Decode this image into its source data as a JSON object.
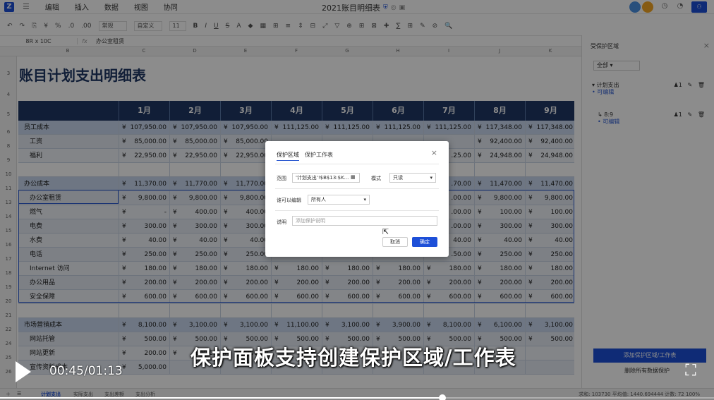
{
  "app": {
    "logo": "Z",
    "menu": [
      "编辑",
      "插入",
      "数据",
      "视图",
      "协同"
    ],
    "title": "2021账目明细表"
  },
  "toolbar": {
    "items": [
      "↶",
      "↷",
      "⎘",
      "¥",
      "%",
      ".0",
      ".00"
    ],
    "format_select": "常规",
    "font_select": "自定义",
    "size_select": "11",
    "style_items": [
      "B",
      "I",
      "U",
      "S",
      "A",
      "◆",
      "▦",
      "⊞",
      "≡",
      "⇕",
      "⊟",
      "⤢",
      "▽",
      "⊕",
      "⊞",
      "⊠",
      "✚",
      "∑",
      "⊞",
      "✎",
      "⊘",
      "🔍"
    ]
  },
  "formula_bar": {
    "name_box": "8R x 10C",
    "fx": "fx",
    "value": "办公室租赁"
  },
  "sheet": {
    "columns": [
      "B",
      "C",
      "D",
      "E",
      "F",
      "G",
      "H",
      "I",
      "J",
      "K"
    ],
    "title": "账目计划支出明细表",
    "months": [
      "1月",
      "2月",
      "3月",
      "4月",
      "5月",
      "6月",
      "7月",
      "8月",
      "9月"
    ],
    "currency": "¥",
    "rows": [
      {
        "num": "6",
        "kind": "cat",
        "label": "员工成本",
        "cur": "¥",
        "values": [
          "107,950.00",
          "107,950.00",
          "107,950.00",
          "111,125.00",
          "111,125.00",
          "111,125.00",
          "111,125.00",
          "117,348.00",
          "117,348.00"
        ],
        "prefix_inline": true
      },
      {
        "num": "8",
        "kind": "sub1",
        "label": "工资",
        "cur": "¥",
        "values": [
          "85,000.00",
          "85,000.00",
          "85,000.00",
          "",
          "",
          "",
          "",
          "92,400.00",
          "92,400.00"
        ]
      },
      {
        "num": "9",
        "kind": "sub2",
        "label": "福利",
        "cur": "¥",
        "values": [
          "22,950.00",
          "22,950.00",
          "22,950.00",
          "",
          "",
          "",
          ".25.00",
          "24,948.00",
          "24,948.00"
        ]
      },
      {
        "num": "10",
        "kind": "blank",
        "label": "",
        "cur": "",
        "values": [
          "",
          "",
          "",
          "",
          "",
          "",
          "",
          "",
          ""
        ]
      },
      {
        "num": "11",
        "kind": "cat",
        "label": "办公成本",
        "cur": "¥",
        "values": [
          "11,370.00",
          "11,770.00",
          "11,770.00",
          "",
          "",
          "",
          ".70.00",
          "11,470.00",
          "11,470.00"
        ]
      },
      {
        "num": "13",
        "kind": "sub1",
        "label": "办公室租赁",
        "cur": "¥",
        "values": [
          "9,800.00",
          "9,800.00",
          "9,800.00",
          "",
          "",
          "",
          ".00.00",
          "9,800.00",
          "9,800.00"
        ]
      },
      {
        "num": "14",
        "kind": "sub2",
        "label": "燃气",
        "cur": "¥",
        "values": [
          "-",
          "400.00",
          "400.00",
          "",
          "",
          "",
          ".00.00",
          "100.00",
          "100.00"
        ]
      },
      {
        "num": "15",
        "kind": "sub1",
        "label": "电费",
        "cur": "¥",
        "values": [
          "300.00",
          "300.00",
          "300.00",
          "",
          "",
          "",
          ".00.00",
          "300.00",
          "300.00"
        ]
      },
      {
        "num": "16",
        "kind": "sub2",
        "label": "水费",
        "cur": "¥",
        "values": [
          "40.00",
          "40.00",
          "40.00",
          "",
          "",
          "",
          "40.00",
          "40.00",
          "40.00"
        ]
      },
      {
        "num": "17",
        "kind": "sub1",
        "label": "电话",
        "cur": "¥",
        "values": [
          "250.00",
          "250.00",
          "250.00",
          "",
          "",
          "",
          ".50.00",
          "250.00",
          "250.00"
        ]
      },
      {
        "num": "18",
        "kind": "sub2",
        "label": "Internet 访问",
        "cur": "¥",
        "values": [
          "180.00",
          "180.00",
          "180.00",
          "180.00",
          "180.00",
          "180.00",
          "180.00",
          "180.00",
          "180.00"
        ]
      },
      {
        "num": "19",
        "kind": "sub1",
        "label": "办公用品",
        "cur": "¥",
        "values": [
          "200.00",
          "200.00",
          "200.00",
          "200.00",
          "200.00",
          "200.00",
          "200.00",
          "200.00",
          "200.00"
        ]
      },
      {
        "num": "20",
        "kind": "sub2",
        "label": "安全保障",
        "cur": "¥",
        "values": [
          "600.00",
          "600.00",
          "600.00",
          "600.00",
          "600.00",
          "600.00",
          "600.00",
          "600.00",
          "600.00"
        ]
      },
      {
        "num": "21",
        "kind": "blank",
        "label": "",
        "cur": "",
        "values": [
          "",
          "",
          "",
          "",
          "",
          "",
          "",
          "",
          ""
        ]
      },
      {
        "num": "22",
        "kind": "cat",
        "label": "市场营销成本",
        "cur": "¥",
        "values": [
          "8,100.00",
          "3,100.00",
          "3,100.00",
          "11,100.00",
          "3,100.00",
          "3,900.00",
          "8,100.00",
          "6,100.00",
          "3,100.00"
        ]
      },
      {
        "num": "24",
        "kind": "sub1",
        "label": "网站托管",
        "cur": "¥",
        "values": [
          "500.00",
          "500.00",
          "500.00",
          "500.00",
          "500.00",
          "500.00",
          "500.00",
          "500.00",
          "500.00"
        ]
      },
      {
        "num": "25",
        "kind": "sub2",
        "label": "网站更新",
        "cur": "¥",
        "values": [
          "200.00",
          "200.00",
          "200.00",
          "",
          "",
          "",
          "",
          "",
          ""
        ]
      },
      {
        "num": "26",
        "kind": "sub1",
        "label": "宣传资料成本",
        "cur": "¥",
        "values": [
          "5,000.00",
          "",
          "",
          "",
          "",
          "",
          "",
          "",
          ""
        ]
      }
    ],
    "row_header_nums": [
      "3",
      "4",
      "5",
      "6",
      "8",
      "9",
      "10",
      "11",
      "13",
      "14",
      "15",
      "16",
      "17",
      "18",
      "19",
      "20",
      "21",
      "22",
      "24",
      "25",
      "26"
    ]
  },
  "panel": {
    "title": "受保护区域",
    "filter": "全部",
    "items": [
      {
        "name": "计划支出",
        "status": "可编辑",
        "count": "1"
      },
      {
        "name": "8:9",
        "status": "可编辑",
        "count": "1"
      }
    ],
    "add_button": "添加保护区域/工作表",
    "remove_link": "删除所有数据保护"
  },
  "dialog": {
    "tab_region": "保护区域",
    "tab_sheet": "保护工作表",
    "range_label": "范围",
    "range_value": "'计划支出'!$B$13:$K...",
    "style_label": "模式",
    "style_value": "只读",
    "editor_label": "谁可以编辑",
    "editor_value": "所有人",
    "desc_label": "说明",
    "desc_placeholder": "添加保护说明",
    "cancel": "取消",
    "ok": "确定"
  },
  "bottom": {
    "tabs": [
      "计划支出",
      "实际支出",
      "支出差额",
      "支出分析"
    ],
    "status": "求和: 103730   平均值: 1440.694444   计数: 72      100%"
  },
  "player": {
    "subtitle": "保护面板支持创建保护区域/工作表",
    "time": "00:45/01:13",
    "progress": 0.62
  },
  "colors": {
    "header_band": "#1f3864",
    "accent": "#1d4fd8"
  }
}
